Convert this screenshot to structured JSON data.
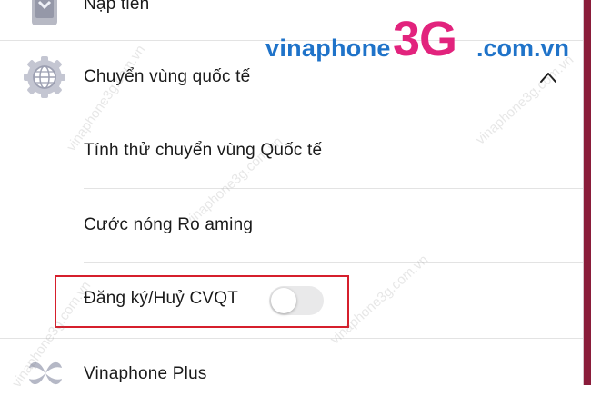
{
  "menu": {
    "items": [
      {
        "label": "Nạp tiền",
        "icon": "phone-card-icon"
      },
      {
        "label": "Chuyển vùng quốc tế",
        "icon": "globe-gear-icon"
      },
      {
        "label": "Tính thử chuyển vùng Quốc tế"
      },
      {
        "label": "Cước nóng Ro aming"
      },
      {
        "label": "Đăng ký/Huỷ CVQT",
        "toggle_on": false
      },
      {
        "label": "Vinaphone Plus",
        "icon": "vinaphone-logo-icon"
      }
    ]
  },
  "brand": {
    "left": "vinaphone",
    "mid": "3G",
    "right": ".com.vn"
  },
  "watermark_text": "vinaphone3g.com.vn",
  "colors": {
    "highlight": "#d61f2c",
    "brand_blue": "#1f73c9",
    "brand_pink": "#e2237d",
    "right_bar": "#8a1c3a"
  }
}
